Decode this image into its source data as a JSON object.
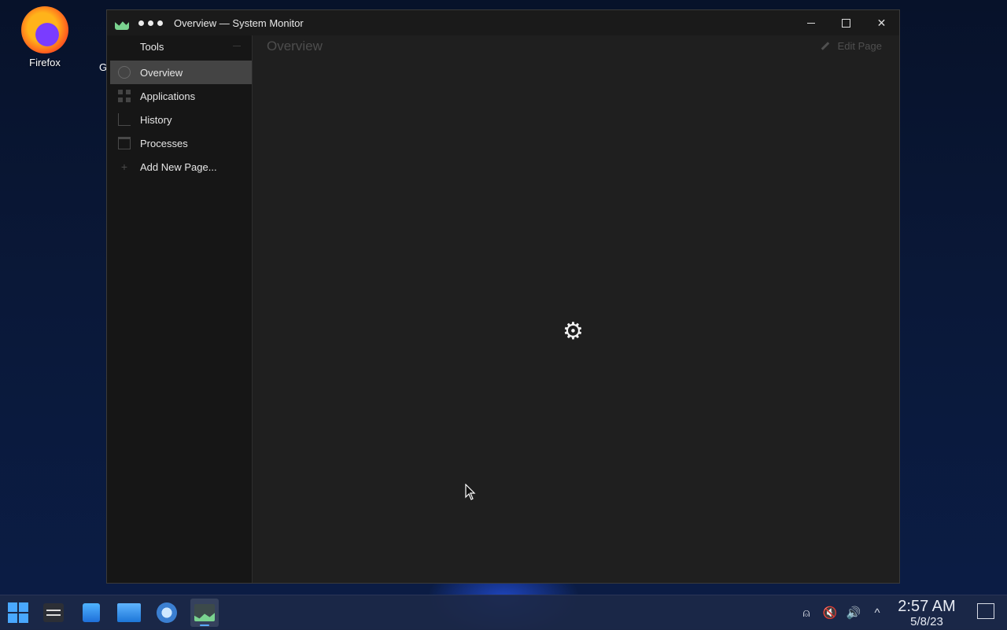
{
  "desktop": {
    "icons": [
      {
        "label": "Firefox",
        "icon": "firefox-icon"
      },
      {
        "label": "G",
        "icon": "app-icon-partial"
      }
    ]
  },
  "window": {
    "title": "Overview — System Monitor",
    "controls": {
      "minimize": "minimize-icon",
      "maximize": "maximize-icon",
      "close": "✕"
    }
  },
  "sidebar": {
    "tools_label": "Tools",
    "items": [
      {
        "label": "Overview",
        "icon": "gauge-icon",
        "active": true
      },
      {
        "label": "Applications",
        "icon": "grid-icon",
        "active": false
      },
      {
        "label": "History",
        "icon": "history-chart-icon",
        "active": false
      },
      {
        "label": "Processes",
        "icon": "process-table-icon",
        "active": false
      },
      {
        "label": "Add New Page...",
        "icon": "plus-icon",
        "active": false
      }
    ]
  },
  "main": {
    "page_title": "Overview",
    "edit_page_label": "Edit Page",
    "busy_glyph": "⚙"
  },
  "taskbar": {
    "apps": [
      {
        "name": "start-menu",
        "icon": "windows-logo-icon"
      },
      {
        "name": "system-settings",
        "icon": "settings-icon"
      },
      {
        "name": "discover-store",
        "icon": "store-icon"
      },
      {
        "name": "file-manager",
        "icon": "folder-icon"
      },
      {
        "name": "network-tool",
        "icon": "network-icon"
      },
      {
        "name": "system-monitor",
        "icon": "system-monitor-icon",
        "active": true
      }
    ],
    "tray": {
      "user_glyph": "⍝",
      "mute_glyph": "🔇",
      "volume_glyph": "🔊",
      "expand_glyph": "^"
    },
    "clock": {
      "time": "2:57 AM",
      "date": "5/8/23"
    }
  },
  "colors": {
    "sidebar_active": "#444444",
    "window_bg": "#1e1e1e",
    "taskbar_accent": "#5aa9ff"
  }
}
